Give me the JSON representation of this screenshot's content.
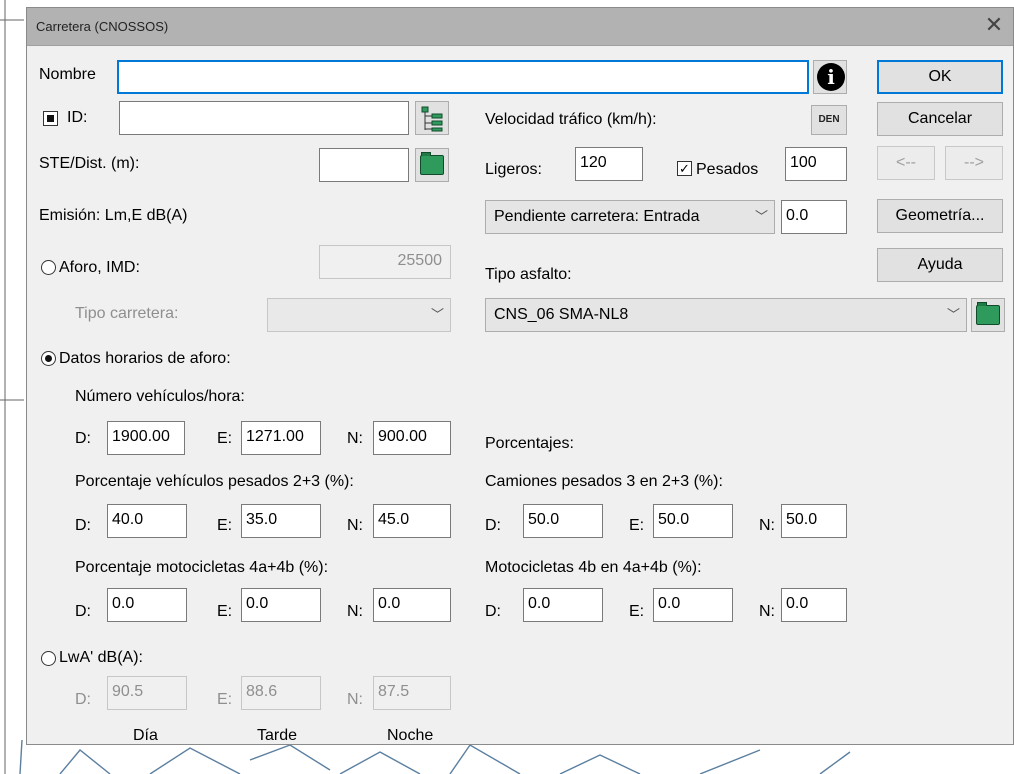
{
  "title": "Carretera (CNOSSOS)",
  "nombre": {
    "label": "Nombre",
    "value": ""
  },
  "id": {
    "label": "ID:",
    "value": ""
  },
  "ste": {
    "label": "STE/Dist. (m):",
    "value": ""
  },
  "emision_label": "Emisión: Lm,E dB(A)",
  "aforo": {
    "label": "Aforo, IMD:",
    "value": "25500",
    "selected": false
  },
  "tipo_carretera": {
    "label": "Tipo carretera:",
    "value": ""
  },
  "datos_horarios": {
    "label": "Datos horarios de aforo:",
    "selected": true
  },
  "vehiculos_hora": {
    "label": "Número vehículos/hora:",
    "d_label": "D:",
    "d": "1900.00",
    "e_label": "E:",
    "e": "1271.00",
    "n_label": "N:",
    "n": "900.00"
  },
  "pesados_pct": {
    "label": "Porcentaje vehículos pesados 2+3 (%):",
    "d_label": "D:",
    "d": "40.0",
    "e_label": "E:",
    "e": "35.0",
    "n_label": "N:",
    "n": "45.0"
  },
  "motos_pct": {
    "label": "Porcentaje motocicletas  4a+4b (%):",
    "d_label": "D:",
    "d": "0.0",
    "e_label": "E:",
    "e": "0.0",
    "n_label": "N:",
    "n": "0.0"
  },
  "lwa": {
    "label": "LwA' dB(A):",
    "selected": false,
    "d_label": "D:",
    "d": "90.5",
    "e_label": "E:",
    "e": "88.6",
    "n_label": "N:",
    "n": "87.5"
  },
  "periodos": {
    "dia": "Día",
    "tarde": "Tarde",
    "noche": "Noche"
  },
  "velocidad": {
    "label": "Velocidad tráfico (km/h):",
    "den": "DEN",
    "ligeros_label": "Ligeros:",
    "ligeros": "120",
    "pesados_label": "Pesados",
    "pesados": "100",
    "pesados_checked": true
  },
  "pendiente": {
    "value": "Pendiente carretera: Entrada",
    "input": "0.0"
  },
  "asfalto": {
    "label": "Tipo asfalto:",
    "value": "CNS_06 SMA-NL8"
  },
  "porcentajes_label": "Porcentajes:",
  "camiones": {
    "label": "Camiones pesados 3 en 2+3 (%):",
    "d_label": "D:",
    "d": "50.0",
    "e_label": "E:",
    "e": "50.0",
    "n_label": "N:",
    "n": "50.0"
  },
  "motos4b": {
    "label": "Motocicletas 4b en 4a+4b (%):",
    "d_label": "D:",
    "d": "0.0",
    "e_label": "E:",
    "e": "0.0",
    "n_label": "N:",
    "n": "0.0"
  },
  "buttons": {
    "ok": "OK",
    "cancel": "Cancelar",
    "prev": "<--",
    "next": "-->",
    "geometry": "Geometría...",
    "help": "Ayuda"
  },
  "close": "✕",
  "icons": [
    "info-icon",
    "tree-icon",
    "den-icon",
    "folder-icon",
    "chevron-down-icon",
    "close-icon"
  ]
}
